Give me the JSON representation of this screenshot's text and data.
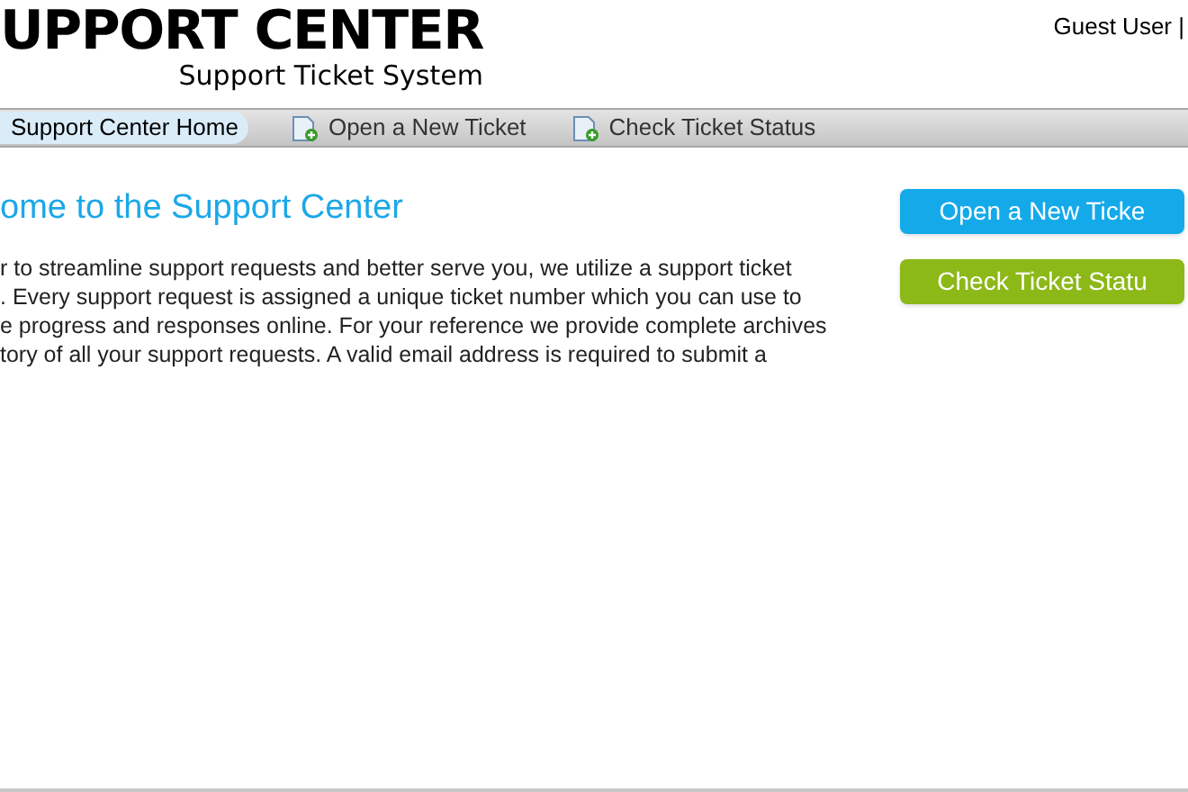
{
  "header": {
    "logo": "UPPORT CENTER",
    "subtitle": "Support Ticket System",
    "user": "Guest User |"
  },
  "nav": [
    {
      "label": "Support Center Home",
      "selected": true,
      "icon": false
    },
    {
      "label": "Open a New Ticket",
      "selected": false,
      "icon": true
    },
    {
      "label": "Check Ticket Status",
      "selected": false,
      "icon": true
    }
  ],
  "main": {
    "title": "ome to the Support Center",
    "paragraph_lines": [
      "r to streamline support requests and better serve you, we utilize a support ticket",
      ". Every support request is assigned a unique ticket number which you can use to",
      "e progress and responses online. For your reference we provide complete archives",
      "tory of all your support requests. A valid email address is required to submit a"
    ]
  },
  "buttons": [
    {
      "label": "Open a New Ticke",
      "kind": "open"
    },
    {
      "label": "Check Ticket Statu",
      "kind": "check"
    }
  ]
}
